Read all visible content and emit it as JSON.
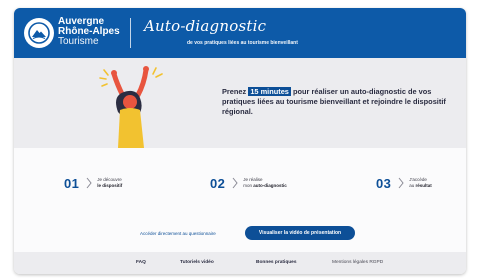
{
  "brand": {
    "line1": "Auvergne",
    "line2": "Rhône-Alpes",
    "line3": "Tourisme",
    "colors": {
      "primary": "#0d5aa8",
      "dark": "#0d4f97",
      "hero_bg": "#ececef",
      "accent_yellow": "#f2c230",
      "illus_red": "#e8553f"
    }
  },
  "header": {
    "title": "Auto-diagnostic",
    "subtitle": "de vos pratiques liées au tourisme bienveillant"
  },
  "hero": {
    "text_before": "Prenez",
    "highlight": "15 minutes",
    "text_after": "pour réaliser un auto-diagnostic de vos pratiques liées au tourisme bienveillant et rejoindre le dispositif régional."
  },
  "steps": [
    {
      "number": "01",
      "line1": "Je découvre",
      "line2": "le dispositif"
    },
    {
      "number": "02",
      "line1": "Je réalise",
      "line2_prefix": "mon",
      "line2": "auto-diagnostic"
    },
    {
      "number": "03",
      "line1": "J'accède",
      "line2_prefix": "au",
      "line2": "résultat"
    }
  ],
  "cta": {
    "link_label": "Accéder directement au questionnaire",
    "button_label": "Visualiser la vidéo de présentation"
  },
  "footer": {
    "items": [
      "FAQ",
      "Tutoriels vidéo",
      "Bonnes pratiques",
      "Mentions légales RGPD"
    ]
  }
}
